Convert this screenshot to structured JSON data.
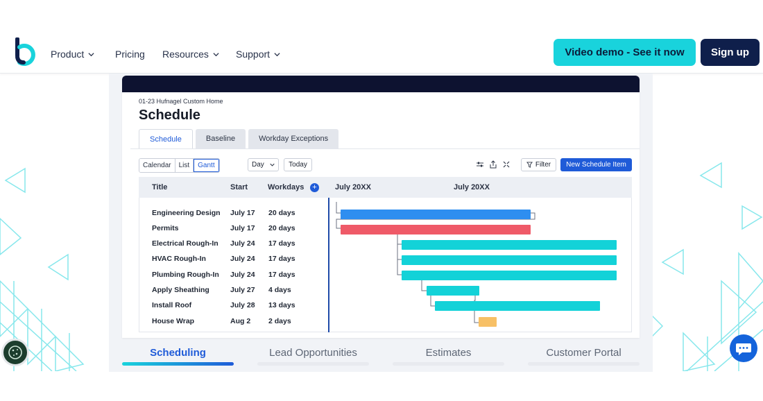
{
  "nav": {
    "items": [
      {
        "label": "Product",
        "dropdown": true
      },
      {
        "label": "Pricing",
        "dropdown": false
      },
      {
        "label": "Resources",
        "dropdown": true
      },
      {
        "label": "Support",
        "dropdown": true
      }
    ],
    "demo_label": "Video demo - See it now",
    "signup_label": "Sign up"
  },
  "app": {
    "project": "01-23 Hufnagel Custom Home",
    "title": "Schedule",
    "tabs": [
      {
        "label": "Schedule",
        "active": true
      },
      {
        "label": "Baseline",
        "active": false
      },
      {
        "label": "Workday Exceptions",
        "active": false
      }
    ],
    "views": [
      {
        "label": "Calendar",
        "active": false
      },
      {
        "label": "List",
        "active": false
      },
      {
        "label": "Gantt",
        "active": true
      }
    ],
    "day_select": "Day",
    "today_label": "Today",
    "filter_label": "Filter",
    "new_item_label": "New Schedule Item",
    "columns": {
      "title": "Title",
      "start": "Start",
      "workdays": "Workdays",
      "add": "+"
    },
    "timeline_headers": [
      "July 20XX",
      "July 20XX"
    ],
    "rows": [
      {
        "title": "Engineering Design",
        "start": "July 17",
        "workdays": "20 days",
        "color": "#2e8ef0"
      },
      {
        "title": "Permits",
        "start": "July 17",
        "workdays": "20 days",
        "color": "#ef5a68"
      },
      {
        "title": "Electrical Rough-In",
        "start": "July 24",
        "workdays": "17 days",
        "color": "#13d2d8"
      },
      {
        "title": "HVAC Rough-In",
        "start": "July 24",
        "workdays": "17 days",
        "color": "#13d2d8"
      },
      {
        "title": "Plumbing Rough-In",
        "start": "July 24",
        "workdays": "17 days",
        "color": "#13d2d8"
      },
      {
        "title": "Apply Sheathing",
        "start": "July 27",
        "workdays": "4 days",
        "color": "#13d2d8"
      },
      {
        "title": "Install Roof",
        "start": "July 28",
        "workdays": "13 days",
        "color": "#13d2d8"
      },
      {
        "title": "House Wrap",
        "start": "Aug 2",
        "workdays": "2 days",
        "color": "#f7c066"
      }
    ]
  },
  "features": [
    {
      "label": "Scheduling",
      "active": true
    },
    {
      "label": "Lead Opportunities",
      "active": false
    },
    {
      "label": "Estimates",
      "active": false
    },
    {
      "label": "Customer Portal",
      "active": false
    }
  ],
  "colors": {
    "accent_cyan": "#19d3dc",
    "brand_navy": "#0f1f4b",
    "primary_blue": "#1f5bd8"
  }
}
